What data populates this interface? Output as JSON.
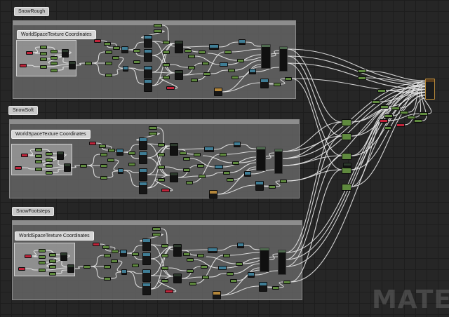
{
  "graph": {
    "groups": [
      {
        "title": "SnowRough",
        "sub_title": "WorldSpaceTexture Coordinates"
      },
      {
        "title": "SnowSoft",
        "sub_title": "WorldSpaceTexture Coordinates"
      },
      {
        "title": "SnowFootsteps",
        "sub_title": "WorldSpaceTexture Coordinates"
      }
    ],
    "watermark": "MATE",
    "colors": {
      "background": "#262626",
      "group": "#707070",
      "node_scalar": "#5f8a3e",
      "node_param": "#c0243a",
      "node_texture": "#3f7d95",
      "node_output": "#b5873a",
      "wire": "#e8e8e8"
    }
  }
}
